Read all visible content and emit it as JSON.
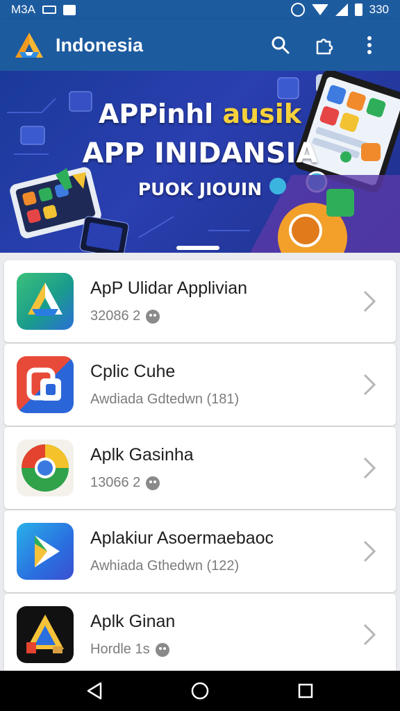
{
  "status_bar": {
    "time_left": "M3A",
    "time_right": "330"
  },
  "app_bar": {
    "title": "Indonesia"
  },
  "banner": {
    "title_line1_a": "APPinhl ",
    "title_line1_b": "ausik",
    "title_line2": "APP INIDANSIA",
    "subtitle": "PUOK JIOUIN"
  },
  "apps": [
    {
      "name": "ApP Ulidar Applivian",
      "sub": "32086 2",
      "has_face": true,
      "icon": "drive-like-icon"
    },
    {
      "name": "Cplic Cuhe",
      "sub": "Awdiada Gdtedwn (181)",
      "has_face": false,
      "icon": "red-blue-app-icon"
    },
    {
      "name": "Aplk Gasinha",
      "sub": "13066 2",
      "has_face": true,
      "icon": "chrome-like-icon"
    },
    {
      "name": "Aplakiur Asoermaebaoc",
      "sub": "Awhiada Gthedwn (122)",
      "has_face": false,
      "icon": "play-arrow-app-icon"
    },
    {
      "name": "Aplk Ginan",
      "sub": "Hordle 1s",
      "has_face": true,
      "icon": "dark-triangle-app-icon"
    }
  ],
  "colors": {
    "primary": "#1d5b9f",
    "banner": "#2a3fb0",
    "nav": "#000000"
  }
}
